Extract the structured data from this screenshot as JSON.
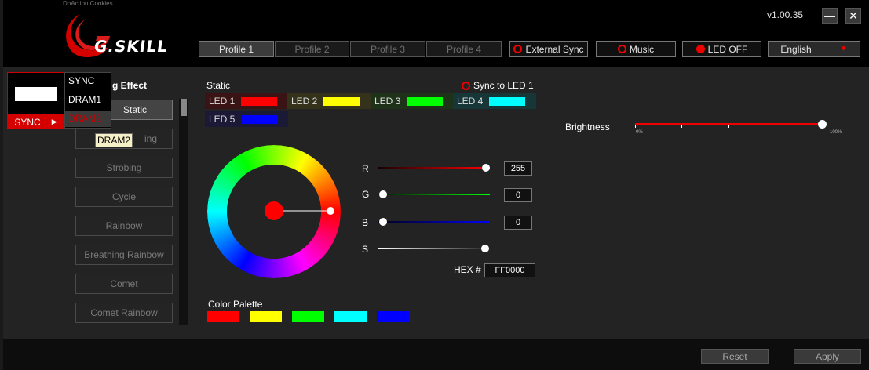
{
  "app": {
    "title_strip": "DoAction Cookies",
    "logo_text": "G.SKILL",
    "version": "v1.00.35",
    "minimize": "—",
    "close": "✕"
  },
  "profiles": [
    {
      "label": "Profile 1",
      "active": true
    },
    {
      "label": "Profile 2",
      "active": false
    },
    {
      "label": "Profile 3",
      "active": false
    },
    {
      "label": "Profile 4",
      "active": false
    }
  ],
  "toggles": {
    "external_sync": "External Sync",
    "music": "Music",
    "led_off": "LED OFF"
  },
  "language": {
    "selected": "English"
  },
  "device_menu": {
    "selected": "SYNC",
    "items": [
      "SYNC",
      "DRAM1",
      "DRAM2"
    ],
    "tooltip": "DRAM2"
  },
  "effects": {
    "header": "Lighting Effect",
    "header_visible": "g Effect",
    "items": [
      "Static",
      "Breathing",
      "Strobing",
      "Cycle",
      "Rainbow",
      "Breathing Rainbow",
      "Comet",
      "Comet Rainbow"
    ],
    "static_visible": "Static",
    "breathing_visible": "ing",
    "selected": "Static"
  },
  "static_panel": {
    "title": "Static",
    "sync_to_led": "Sync to LED 1",
    "leds": [
      {
        "label": "LED 1",
        "color": "#ff0000",
        "tile": "#3a1414"
      },
      {
        "label": "LED 2",
        "color": "#ffff00",
        "tile": "#34321a"
      },
      {
        "label": "LED 3",
        "color": "#00ff00",
        "tile": "#1d3218"
      },
      {
        "label": "LED 4",
        "color": "#00ffff",
        "tile": "#163638"
      },
      {
        "label": "LED 5",
        "color": "#0000ff",
        "tile": "#1a1a36"
      }
    ]
  },
  "rgb": {
    "r_label": "R",
    "r_value": "255",
    "g_label": "G",
    "g_value": "0",
    "b_label": "B",
    "b_value": "0",
    "s_label": "S",
    "hex_label": "HEX #",
    "hex_value": "FF0000"
  },
  "palette": {
    "label": "Color Palette",
    "colors": [
      "#ff0000",
      "#ffff00",
      "#00ff00",
      "#00ffff",
      "#0000ff"
    ]
  },
  "brightness": {
    "label": "Brightness",
    "value": 100,
    "min_label": "0%",
    "max_label": "100%"
  },
  "footer": {
    "reset": "Reset",
    "apply": "Apply"
  },
  "colors": {
    "accent": "#e00000",
    "panel": "#232323"
  }
}
